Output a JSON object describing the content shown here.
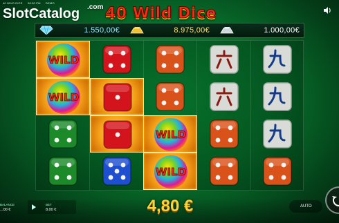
{
  "topbar": {
    "game": "40 WILD DICE",
    "time": "08:30 PM",
    "mode": "DEMO"
  },
  "brand": {
    "name": "SlotCatalog",
    "suffix": ".com"
  },
  "title": "40 Wild Dice",
  "icons": {
    "sound": "speaker-icon",
    "diamond": "diamond-icon",
    "gold": "gold-bar-icon",
    "silver": "silver-bar-icon",
    "spin": "spin-icon",
    "play": "play-icon"
  },
  "jackpots": [
    {
      "name": "diamond",
      "value": "1.550,00€"
    },
    {
      "name": "gold",
      "value": "8.975,00€"
    },
    {
      "name": "silver",
      "value": "1.000,00€"
    }
  ],
  "reels": [
    [
      "WILD",
      "WILD",
      "dice-green-4",
      "dice-green-4"
    ],
    [
      "dice-red-4",
      "dice-red-1",
      "dice-red-1",
      "dice-blue-5"
    ],
    [
      "dice-orange-4",
      "dice-orange-4",
      "WILD",
      "WILD"
    ],
    [
      "tile-six",
      "tile-six",
      "dice-orange-4",
      "dice-orange-4"
    ],
    [
      "tile-nine",
      "tile-nine",
      "tile-nine",
      "dice-orange-4"
    ]
  ],
  "highlighted": [
    "0-0",
    "0-1",
    "1-1",
    "1-2",
    "2-2",
    "2-3"
  ],
  "colors": {
    "red": "#d4141c",
    "green": "#1d8a2a",
    "blue": "#1e4fd1",
    "orange": "#d8521a",
    "win": "#ffd23a"
  },
  "bottom": {
    "balance_label": "BALANCE",
    "balance_value": "...00 €",
    "bet_label": "BET",
    "bet_value": "8,00 €",
    "win_value": "4,80 €",
    "auto_label": "AUTO"
  }
}
